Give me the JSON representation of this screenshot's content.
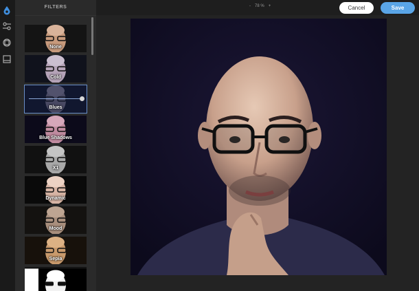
{
  "panel": {
    "title": "FILTERS",
    "filters": [
      {
        "label": "None"
      },
      {
        "label": "Cold"
      },
      {
        "label": "Blues"
      },
      {
        "label": "Blue Shadows"
      },
      {
        "label": "X1"
      },
      {
        "label": "Dynamic"
      },
      {
        "label": "Mood"
      },
      {
        "label": "Sepia"
      }
    ],
    "selected": "Blues"
  },
  "toolbar": {
    "zoom_minus": "-",
    "zoom_value": "78 %",
    "zoom_plus": "+",
    "cancel_label": "Cancel",
    "save_label": "Save"
  },
  "rail": {
    "icons": [
      "filter-drop-icon",
      "adjust-icon",
      "crop-icon",
      "frame-icon"
    ]
  },
  "colors": {
    "accent": "#5aa5e6",
    "panel": "#2a2a2a",
    "background": "#1e1e1e"
  }
}
